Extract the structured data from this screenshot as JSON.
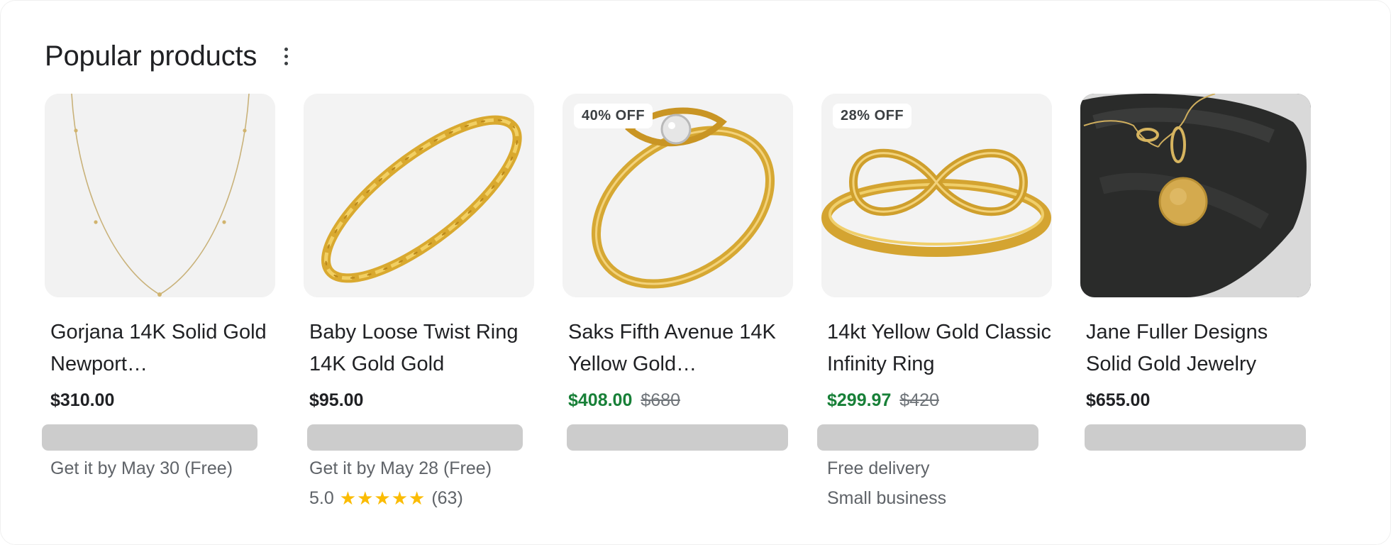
{
  "section": {
    "title": "Popular products",
    "menu_icon": "more-vert-icon"
  },
  "colors": {
    "sale_price": "#188038",
    "star": "#fbbc04",
    "redacted": "#cccccc"
  },
  "products": [
    {
      "name": "Gorjana 14K Solid Gold Newport…",
      "price": "$310.00",
      "delivery": "Get it by May 30 (Free)"
    },
    {
      "name": "Baby Loose Twist Ring 14K Gold Gold",
      "price": "$95.00",
      "delivery": "Get it by May 28 (Free)",
      "rating": {
        "score": "5.0",
        "stars": "★★★★★",
        "count": "(63)"
      }
    },
    {
      "badge": "40% OFF",
      "name": "Saks Fifth Avenue 14K Yellow Gold…",
      "price": "$408.00",
      "old_price": "$680"
    },
    {
      "badge": "28% OFF",
      "name": "14kt Yellow Gold Classic Infinity Ring",
      "price": "$299.97",
      "old_price": "$420",
      "delivery": "Free delivery",
      "tag": "Small business"
    },
    {
      "name": "Jane Fuller Designs Solid Gold Jewelry",
      "price": "$655.00"
    }
  ]
}
